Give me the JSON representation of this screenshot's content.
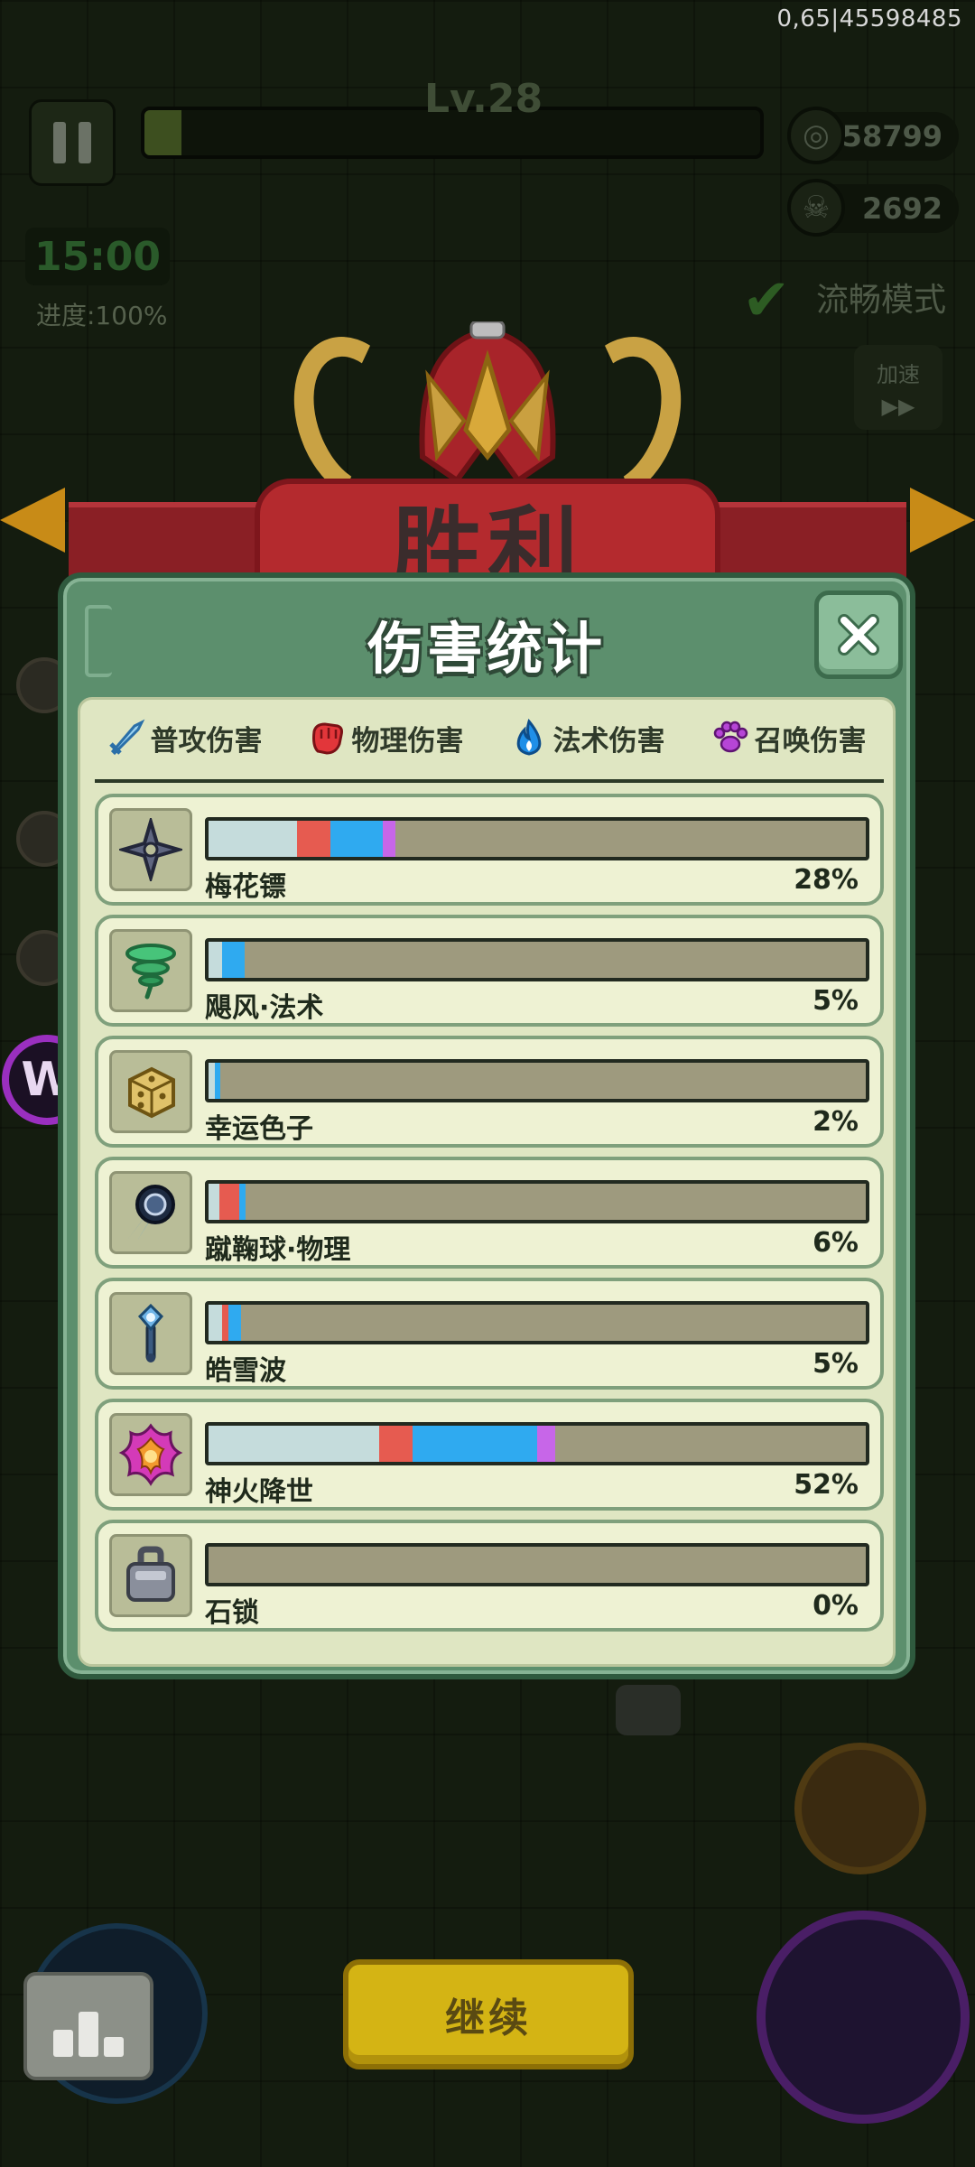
{
  "hud": {
    "debug_id": "0,65|45598485",
    "level": "Lv.28",
    "xp_fraction": 0.06,
    "coins": "58799",
    "kills": "2692",
    "timer": "15:00",
    "progress": "进度:100%",
    "smooth_mode": "流畅模式",
    "speed_label": "加速",
    "speed_icon": "▶▶"
  },
  "banner": {
    "title": "胜利"
  },
  "modal": {
    "title": "伤害统计",
    "legend": [
      {
        "icon": "sword-icon",
        "label": "普攻伤害",
        "color": "#9ad2f0"
      },
      {
        "icon": "fist-icon",
        "label": "物理伤害",
        "color": "#e2363a"
      },
      {
        "icon": "flame-icon",
        "label": "法术伤害",
        "color": "#1f8fe8"
      },
      {
        "icon": "paw-icon",
        "label": "召唤伤害",
        "color": "#b645d6"
      }
    ],
    "rows": [
      {
        "name": "梅花镖",
        "percent": "28%",
        "icon": "shuriken-icon",
        "segments": [
          0.135,
          0.05,
          0.08,
          0.02
        ]
      },
      {
        "name": "飓风·法术",
        "percent": "5%",
        "icon": "tornado-icon",
        "segments": [
          0.02,
          0.0,
          0.035,
          0.0
        ]
      },
      {
        "name": "幸运色子",
        "percent": "2%",
        "icon": "dice-icon",
        "segments": [
          0.01,
          0.0,
          0.008,
          0.0
        ]
      },
      {
        "name": "蹴鞠球·物理",
        "percent": "6%",
        "icon": "ball-icon",
        "segments": [
          0.017,
          0.03,
          0.01,
          0.0
        ]
      },
      {
        "name": "皓雪波",
        "percent": "5%",
        "icon": "scepter-icon",
        "segments": [
          0.02,
          0.01,
          0.02,
          0.0
        ]
      },
      {
        "name": "神火降世",
        "percent": "52%",
        "icon": "fire-phoenix-icon",
        "segments": [
          0.26,
          0.05,
          0.19,
          0.028
        ]
      },
      {
        "name": "石锁",
        "percent": "0%",
        "icon": "stone-lock-icon",
        "segments": [
          0.0,
          0.0,
          0.0,
          0.0
        ]
      }
    ]
  },
  "buttons": {
    "continue": "继续"
  },
  "colors": {
    "attack": "#c5dcdc",
    "physical": "#e65b50",
    "magic": "#2faaf0",
    "summon": "#c766e8"
  }
}
